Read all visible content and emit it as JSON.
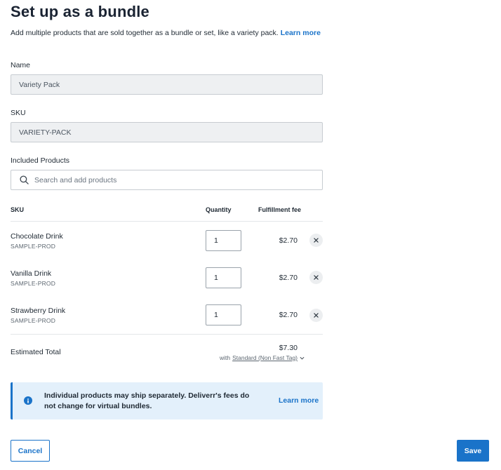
{
  "page": {
    "title": "Set up as a bundle",
    "subtitle": "Add multiple products that are sold together as a bundle or set, like a variety pack.",
    "learn_more": "Learn more"
  },
  "form": {
    "name_label": "Name",
    "name_value": "Variety Pack",
    "sku_label": "SKU",
    "sku_value": "VARIETY-PACK",
    "included_label": "Included Products",
    "search_placeholder": "Search and add products"
  },
  "table": {
    "headers": {
      "sku": "SKU",
      "quantity": "Quantity",
      "fee": "Fulfillment fee"
    },
    "rows": [
      {
        "name": "Chocolate Drink",
        "sku": "SAMPLE-PROD",
        "quantity": "1",
        "fee": "$2.70"
      },
      {
        "name": "Vanilla Drink",
        "sku": "SAMPLE-PROD",
        "quantity": "1",
        "fee": "$2.70"
      },
      {
        "name": "Strawberry Drink",
        "sku": "SAMPLE-PROD",
        "quantity": "1",
        "fee": "$2.70"
      }
    ]
  },
  "total": {
    "label": "Estimated Total",
    "value": "$7.30",
    "ship_prefix": "with",
    "ship_option": "Standard (Non Fast Tag)"
  },
  "info": {
    "text": "Individual products may ship separately. Deliverr's fees do not change for virtual bundles.",
    "link": "Learn more"
  },
  "actions": {
    "cancel": "Cancel",
    "save": "Save"
  },
  "icons": {
    "search": "search-icon",
    "remove": "close-icon",
    "info": "info-icon",
    "chevron": "chevron-down-icon"
  },
  "colors": {
    "accent": "#1a73c9",
    "info_bg": "#e3f0fb",
    "disabled_bg": "#eef0f2"
  }
}
